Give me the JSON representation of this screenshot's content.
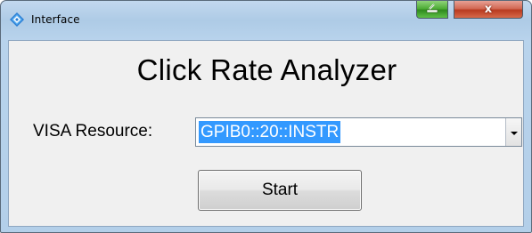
{
  "window": {
    "title": "Interface",
    "app_icon": "diamond-app-icon",
    "minimize_icon": "minimize-icon",
    "close_glyph": "x",
    "close_icon": "close-icon"
  },
  "main": {
    "heading": "Click Rate Analyzer",
    "visa_label": "VISA Resource:",
    "visa_value": "GPIB0::20::INSTR",
    "dropdown_icon": "chevron-down-icon",
    "start_label": "Start"
  },
  "colors": {
    "selection_highlight": "#3399ff",
    "minimize_button": "#4fae37",
    "close_button": "#c8452a",
    "client_background": "#f0f0f0"
  }
}
